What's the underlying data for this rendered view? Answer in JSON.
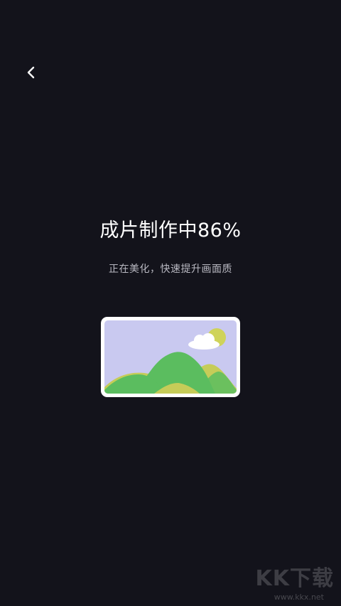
{
  "progress": {
    "title": "成片制作中86%",
    "percent": 86,
    "subtitle": "正在美化，快速提升画面质"
  },
  "colors": {
    "background": "#13131b",
    "sky": "#c9c9f0",
    "sun": "#cfd35a",
    "hill_green": "#5bbd5f",
    "hill_yellow": "#c6cc58"
  },
  "watermark": {
    "logo": "KK下载",
    "url": "www.kkx.net"
  }
}
